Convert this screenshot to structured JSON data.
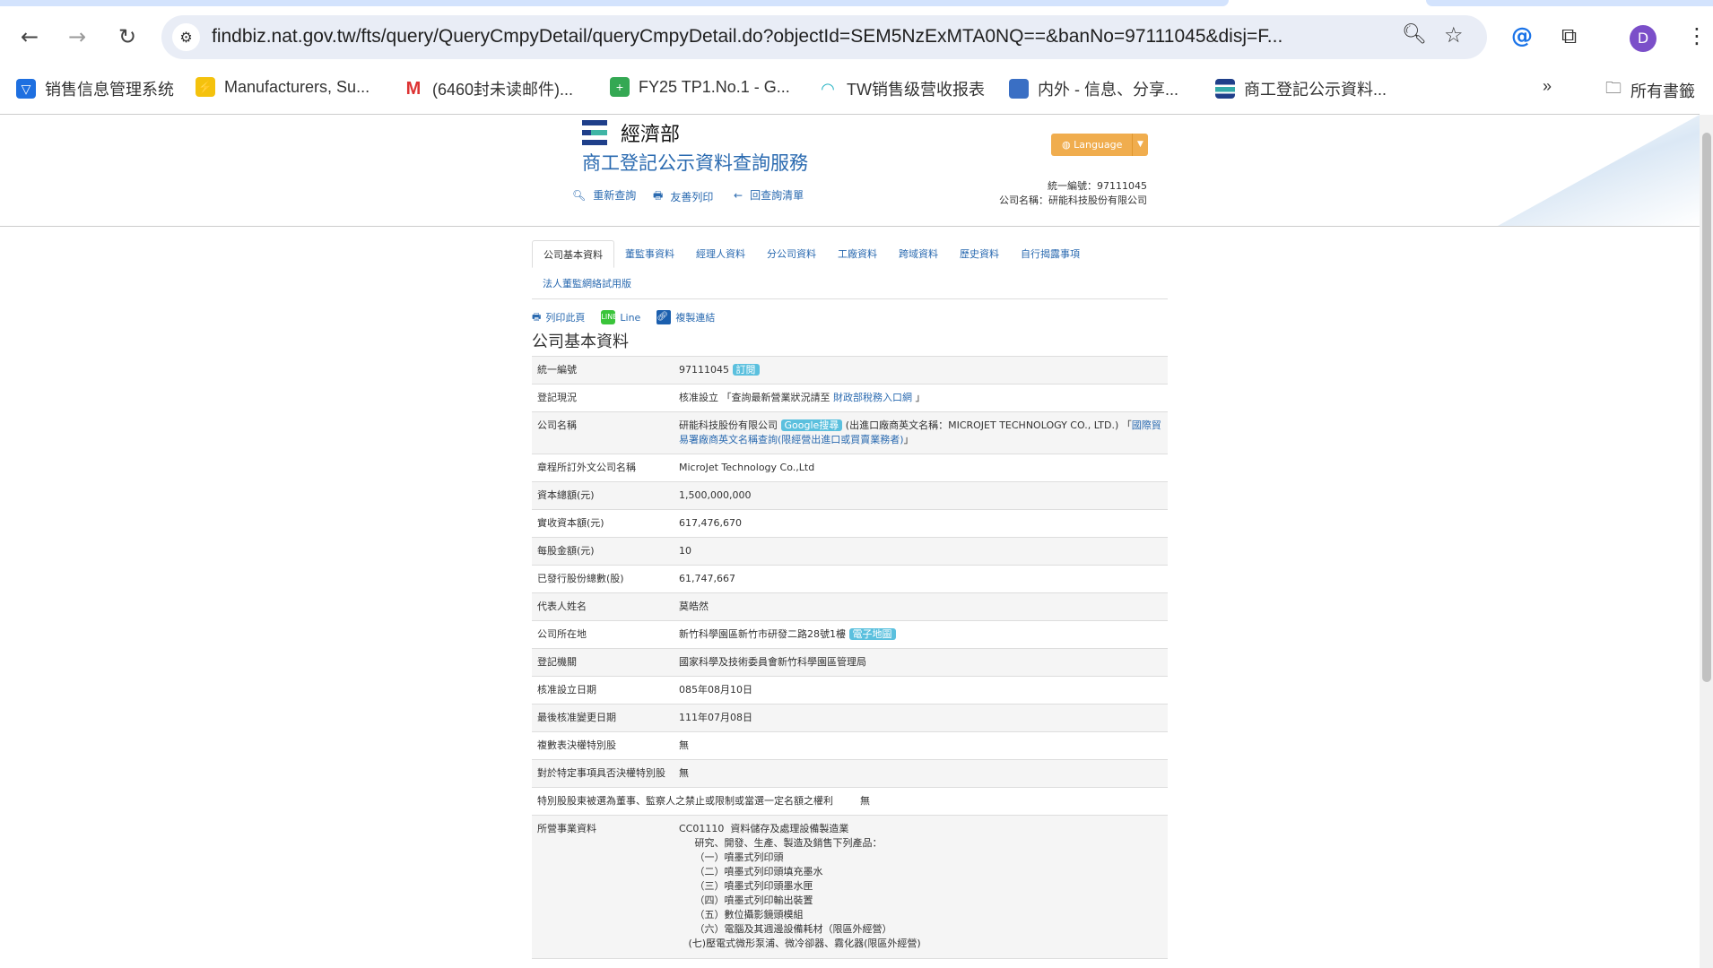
{
  "browser": {
    "url": "findbiz.nat.gov.tw/fts/query/QueryCmpyDetail/queryCmpyDetail.do?objectId=SEM5NzExMTA0NQ==&banNo=97111045&disj=F...",
    "avatar": "D",
    "bookmarks": [
      "销售信息管理系统",
      "Manufacturers, Su...",
      "(6460封未读邮件)...",
      "FY25 TP1.No.1 - G...",
      "TW销售级营收报表",
      "内外 - 信息、分享...",
      "商工登記公示資料..."
    ],
    "all_bookmarks": "所有書籤"
  },
  "header": {
    "ministry": "經濟部",
    "title": "商工登記公示資料查詢服務",
    "language": "Language",
    "links": [
      "重新查詢",
      "友善列印",
      "回查詢清單"
    ],
    "ban_line": "統一編號：97111045",
    "name_line": "公司名稱：研能科技股份有限公司"
  },
  "tabs": [
    "公司基本資料",
    "董監事資料",
    "經理人資料",
    "分公司資料",
    "工廠資料",
    "跨域資料",
    "歷史資料",
    "自行揭露事項",
    "法人董監網絡試用版"
  ],
  "actions": {
    "print": "列印此頁",
    "line": "Line",
    "copy": "複製連結"
  },
  "section_title": "公司基本資料",
  "rows": [
    {
      "label": "統一編號",
      "value": "97111045",
      "badge": "訂閱"
    },
    {
      "label": "登記現況",
      "value": "核准設立 「查詢最新營業狀況請至 ",
      "link": "財政部稅務入口網",
      "suffix": " 」"
    },
    {
      "label": "公司名稱",
      "value": "研能科技股份有限公司 ",
      "badge": "Google搜尋",
      "suffix": " (出進口廠商英文名稱：MICROJET TECHNOLOGY CO., LTD.) 「",
      "link": "國際貿易署廠商英文名稱查詢(限經營出進口或買賣業務者)",
      "suffix2": "」"
    },
    {
      "label": "章程所訂外文公司名稱",
      "value": "MicroJet Technology Co.,Ltd"
    },
    {
      "label": "資本總額(元)",
      "value": "1,500,000,000"
    },
    {
      "label": "實收資本額(元)",
      "value": "617,476,670"
    },
    {
      "label": "每股金額(元)",
      "value": "10"
    },
    {
      "label": "已發行股份總數(股)",
      "value": "61,747,667"
    },
    {
      "label": "代表人姓名",
      "value": "莫皓然"
    },
    {
      "label": "公司所在地",
      "value": "新竹科學園區新竹市研發二路28號1樓",
      "badge": "電子地圖"
    },
    {
      "label": "登記機關",
      "value": "國家科學及技術委員會新竹科學園區管理局"
    },
    {
      "label": "核准設立日期",
      "value": "085年08月10日"
    },
    {
      "label": "最後核准變更日期",
      "value": "111年07月08日"
    },
    {
      "label": "複數表決權特別股",
      "value": "無"
    },
    {
      "label": "對於特定事項具否決權特別股",
      "value": "無"
    },
    {
      "label": "特別股股東被選為董事、監察人之禁止或限制或當選一定名額之權利",
      "value": "無"
    }
  ],
  "business": {
    "label": "所營事業資料",
    "lines": [
      "CC01110  資料儲存及處理設備製造業",
      "     研究、開發、生產、製造及銷售下列產品：",
      "     （一）噴墨式列印頭",
      "     （二）噴墨式列印頭填充墨水",
      "     （三）噴墨式列印頭墨水匣",
      "     （四）噴墨式列印輸出裝置",
      "     （五）數位攝影鏡頭模組",
      "     （六）電腦及其週邊設備耗材（限區外經營）",
      "   (七)壓電式微形泵浦、微冷卻器、霧化器(限區外經營)"
    ]
  }
}
